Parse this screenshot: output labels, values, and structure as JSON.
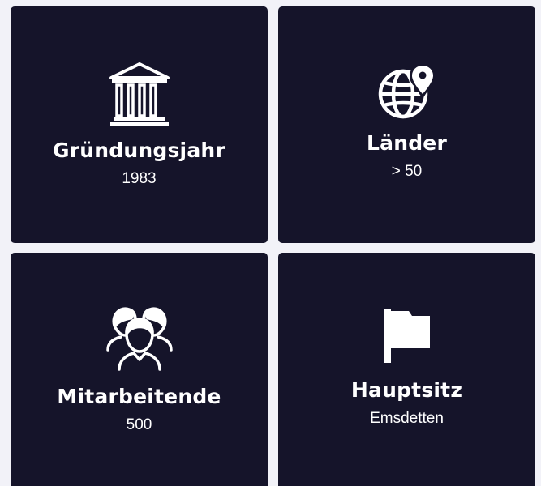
{
  "cards": [
    {
      "title": "Gründungsjahr",
      "value": "1983",
      "icon": "building-columns-icon"
    },
    {
      "title": "Länder",
      "value": "> 50",
      "icon": "globe-location-pin-icon"
    },
    {
      "title": "Mitarbeitende",
      "value": "500",
      "icon": "people-group-icon"
    },
    {
      "title": "Hauptsitz",
      "value": "Emsdetten",
      "icon": "flag-icon"
    }
  ],
  "colors": {
    "page_background": "#f2f2f8",
    "card_background": "#15142a",
    "text": "#ffffff"
  }
}
